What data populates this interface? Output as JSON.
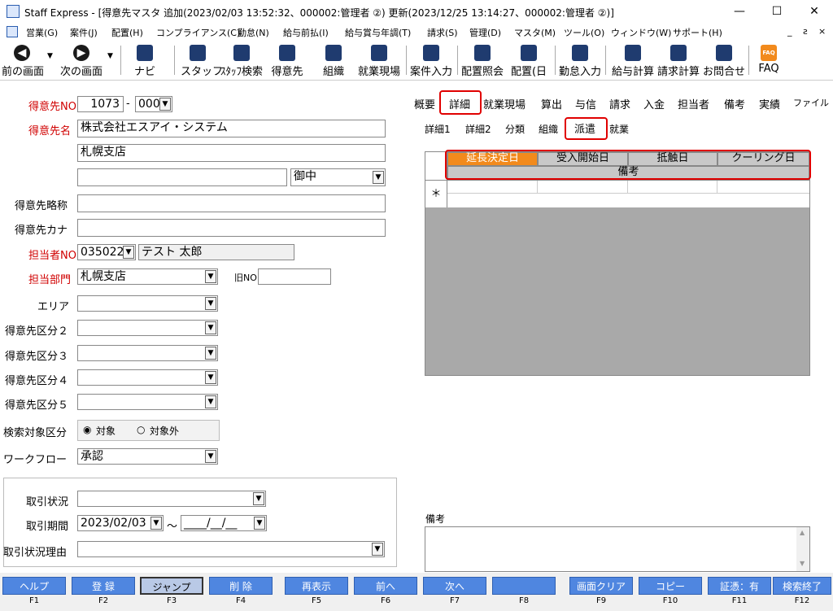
{
  "window": {
    "title": "Staff Express - [得意先マスタ 追加(2023/02/03 13:52:32、000002:管理者 ②) 更新(2023/12/25 13:14:27、000002:管理者 ②)]"
  },
  "menu": [
    "営業(G)",
    "案件(J)",
    "配置(H)",
    "コンプライアンス(C)",
    "勤怠(N)",
    "給与前払(I)",
    "給与賞与年調(T)",
    "請求(S)",
    "管理(D)",
    "マスタ(M)",
    "ツール(O)",
    "ウィンドウ(W)",
    "サポート(H)"
  ],
  "toolbar": {
    "prev": "前の画面",
    "next": "次の画面",
    "navi": "ナビ",
    "staff": "スタッフ",
    "staff_search": "ｽﾀｯﾌ検索",
    "customer": "得意先",
    "org": "組織",
    "worksite": "就業現場",
    "case_input": "案件入力",
    "assign_query": "配置照会",
    "assign_day": "配置(日",
    "attendance": "勤怠入力",
    "payroll": "給与計算",
    "billing": "請求計算",
    "inquiry": "お問合せ",
    "faq": "FAQ",
    "faq_icon": "FAQ"
  },
  "form": {
    "customer_no_label": "得意先NO",
    "customer_no": "1073",
    "customer_no_sep": "-",
    "customer_sub": "000",
    "customer_name_label": "得意先名",
    "customer_name1": "株式会社エスアイ・システム",
    "customer_name2": "札幌支店",
    "honorific": "御中",
    "short_name_label": "得意先略称",
    "kana_label": "得意先カナ",
    "staff_no_label": "担当者NO",
    "staff_no": "035022",
    "staff_name": "テスト 太郎",
    "dept_label": "担当部門",
    "dept": "札幌支店",
    "old_no_label": "旧NO",
    "area_label": "エリア",
    "class2_label": "得意先区分２",
    "class3_label": "得意先区分３",
    "class4_label": "得意先区分４",
    "class5_label": "得意先区分５",
    "search_target_label": "検索対象区分",
    "radio_target": "対象",
    "radio_nontarget": "対象外",
    "workflow_label": "ワークフロー",
    "workflow": "承認",
    "deal_status_label": "取引状況",
    "deal_period_label": "取引期間",
    "deal_start": "2023/02/03",
    "tilde": "～",
    "deal_end": "____/__/__",
    "deal_reason_label": "取引状況理由"
  },
  "tabs": [
    "概要",
    "詳細",
    "就業現場",
    "算出",
    "与信",
    "請求",
    "入金",
    "担当者",
    "備考",
    "実績",
    "ファイル"
  ],
  "subtabs": [
    "詳細1",
    "詳細2",
    "分類",
    "組織",
    "派遣",
    "就業"
  ],
  "grid": {
    "headers": [
      "延長決定日",
      "受入開始日",
      "抵触日",
      "クーリング日"
    ],
    "sub_header": "備考",
    "new_row_marker": "＊"
  },
  "remarks_label": "備考",
  "fkeys": [
    {
      "label": "ヘルプ",
      "key": "F1"
    },
    {
      "label": "登 録",
      "key": "F2"
    },
    {
      "label": "ジャンプ",
      "key": "F3"
    },
    {
      "label": "削 除",
      "key": "F4"
    },
    {
      "label": "再表示",
      "key": "F5"
    },
    {
      "label": "前へ",
      "key": "F6"
    },
    {
      "label": "次へ",
      "key": "F7"
    },
    {
      "label": "",
      "key": "F8"
    },
    {
      "label": "画面クリア",
      "key": "F9"
    },
    {
      "label": "コピー",
      "key": "F10"
    },
    {
      "label": "証憑：有",
      "key": "F11"
    },
    {
      "label": "検索終了",
      "key": "F12"
    }
  ],
  "colors": {
    "accent_red": "#e00000",
    "fkey_blue": "#4f86e0",
    "grid_orange": "#f28a1c"
  }
}
